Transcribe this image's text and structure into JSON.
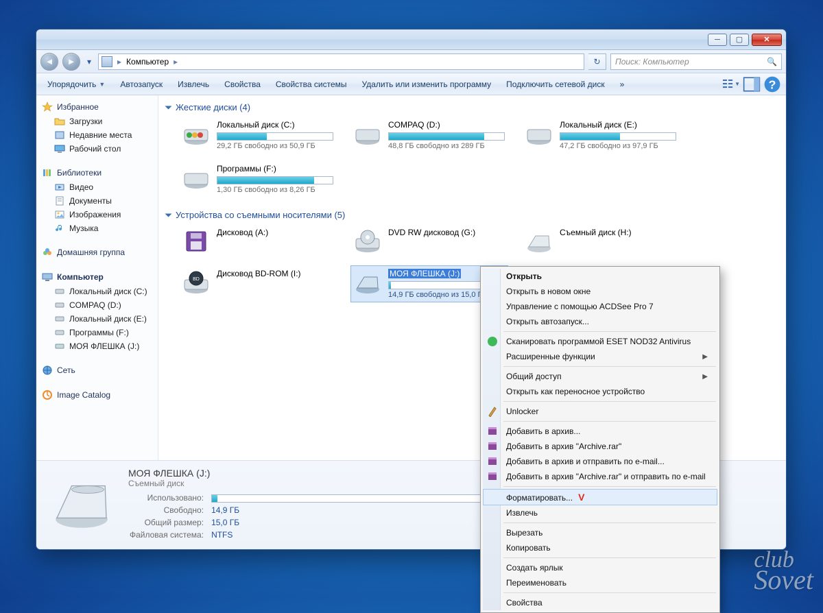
{
  "breadcrumb": {
    "location": "Компьютер"
  },
  "search": {
    "placeholder": "Поиск: Компьютер"
  },
  "toolbar": {
    "organize": "Упорядочить",
    "autoplay": "Автозапуск",
    "eject": "Извлечь",
    "properties": "Свойства",
    "sysprops": "Свойства системы",
    "programs": "Удалить или изменить программу",
    "mapdrive": "Подключить сетевой диск",
    "more": "»"
  },
  "sidebar": {
    "favorites": "Избранное",
    "fav_items": [
      "Загрузки",
      "Недавние места",
      "Рабочий стол"
    ],
    "libraries": "Библиотеки",
    "lib_items": [
      "Видео",
      "Документы",
      "Изображения",
      "Музыка"
    ],
    "homegroup": "Домашняя группа",
    "computer": "Компьютер",
    "comp_items": [
      "Локальный диск (C:)",
      "COMPAQ (D:)",
      "Локальный диск (E:)",
      "Программы  (F:)",
      "МОЯ ФЛЕШКА (J:)"
    ],
    "network": "Сеть",
    "image_catalog": "Image Catalog"
  },
  "sections": {
    "hdd": "Жесткие диски (4)",
    "removable": "Устройства со съемными носителями (5)"
  },
  "drives": {
    "c": {
      "title": "Локальный диск (C:)",
      "sub": "29,2 ГБ свободно из 50,9 ГБ",
      "pct": 43
    },
    "d": {
      "title": "COMPAQ (D:)",
      "sub": "48,8 ГБ свободно из 289 ГБ",
      "pct": 83
    },
    "e": {
      "title": "Локальный диск (E:)",
      "sub": "47,2 ГБ свободно из 97,9 ГБ",
      "pct": 52
    },
    "f": {
      "title": "Программы  (F:)",
      "sub": "1,30 ГБ свободно из 8,26 ГБ",
      "pct": 84
    },
    "a": {
      "title": "Дисковод (A:)"
    },
    "g": {
      "title": "DVD RW дисковод (G:)"
    },
    "h": {
      "title": "Съемный диск (H:)"
    },
    "i": {
      "title": "Дисковод BD-ROM (I:)"
    },
    "j": {
      "title": "МОЯ ФЛЕШКА (J:)",
      "sub": "14,9 ГБ свободно из 15,0 Г",
      "pct": 2
    }
  },
  "details": {
    "title": "МОЯ ФЛЕШКА (J:)",
    "kind": "Съемный диск",
    "used_label": "Использовано:",
    "free_label": "Свободно:",
    "free_value": "14,9 ГБ",
    "total_label": "Общий размер:",
    "total_value": "15,0 ГБ",
    "fs_label": "Файловая система:",
    "fs_value": "NTFS"
  },
  "ctx": {
    "open": "Открыть",
    "open_new": "Открыть в новом окне",
    "acdsee": "Управление с помощью ACDSee Pro 7",
    "autoplay": "Открыть автозапуск...",
    "nod32": "Сканировать программой ESET NOD32 Antivirus",
    "advanced": "Расширенные функции",
    "share": "Общий доступ",
    "portable": "Открыть как переносное устройство",
    "unlocker": "Unlocker",
    "rar_add": "Добавить в архив...",
    "rar_add_archive": "Добавить в архив \"Archive.rar\"",
    "rar_email": "Добавить в архив и отправить по e-mail...",
    "rar_archive_email": "Добавить в архив \"Archive.rar\" и отправить по e-mail",
    "format": "Форматировать...",
    "eject": "Извлечь",
    "cut": "Вырезать",
    "copy": "Копировать",
    "shortcut": "Создать ярлык",
    "rename": "Переименовать",
    "props": "Свойства"
  },
  "watermark": {
    "l1": "club",
    "l2": "Sovet"
  }
}
